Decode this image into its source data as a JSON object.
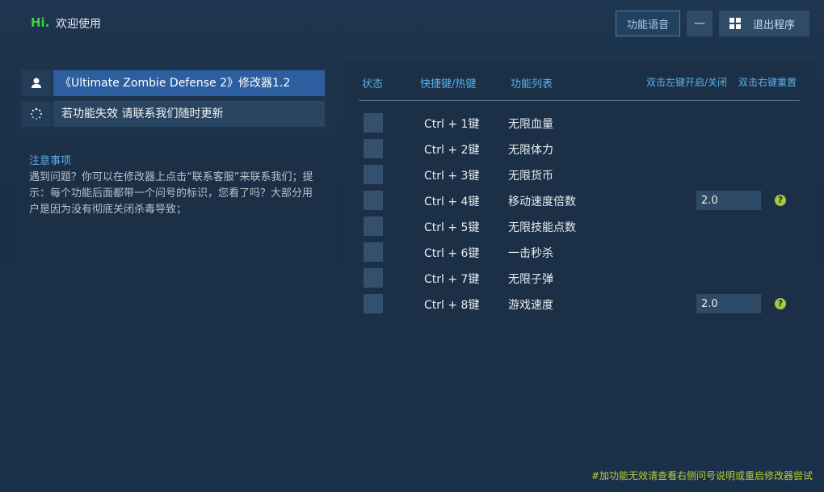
{
  "header": {
    "hi": "Hi.",
    "welcome": "欢迎使用",
    "voice_button": "功能语音",
    "minimize_button": "—",
    "exit_button": "退出程序"
  },
  "game": {
    "title": "《Ultimate Zombie Defense 2》修改器1.2",
    "notice": "若功能失效  请联系我们随时更新"
  },
  "notes": {
    "title": "注意事项",
    "body": "遇到问题？你可以在修改器上点击“联系客服”来联系我们；提示：每个功能后面都带一个问号的标识，您看了吗？大部分用户是因为没有彻底关闭杀毒导致；"
  },
  "table": {
    "headers": {
      "status": "状态",
      "hotkey": "快捷键/热键",
      "features": "功能列表",
      "left_click": "双击左键开启/关闭",
      "right_click": "双击右键重置"
    },
    "rows": [
      {
        "hotkey": "Ctrl  +  1键",
        "feature": "无限血量"
      },
      {
        "hotkey": "Ctrl  +  2键",
        "feature": "无限体力"
      },
      {
        "hotkey": "Ctrl  +  3键",
        "feature": "无限货币"
      },
      {
        "hotkey": "Ctrl  +  4键",
        "feature": "移动速度倍数",
        "value": "2.0",
        "help": "?"
      },
      {
        "hotkey": "Ctrl  +  5键",
        "feature": "无限技能点数"
      },
      {
        "hotkey": "Ctrl  +  6键",
        "feature": "一击秒杀"
      },
      {
        "hotkey": "Ctrl  +  7键",
        "feature": "无限子弹"
      },
      {
        "hotkey": "Ctrl  +  8键",
        "feature": "游戏速度",
        "value": "2.0",
        "help": "?"
      }
    ]
  },
  "footer": "#加功能无效请查看右侧问号说明或重启修改器尝试",
  "colors": {
    "accent_green": "#3ed33e",
    "title_blue": "#5ab0e8",
    "selected_bar": "#2d5fa0",
    "help_badge": "#a6c93a",
    "footer_text": "#b3d230"
  }
}
